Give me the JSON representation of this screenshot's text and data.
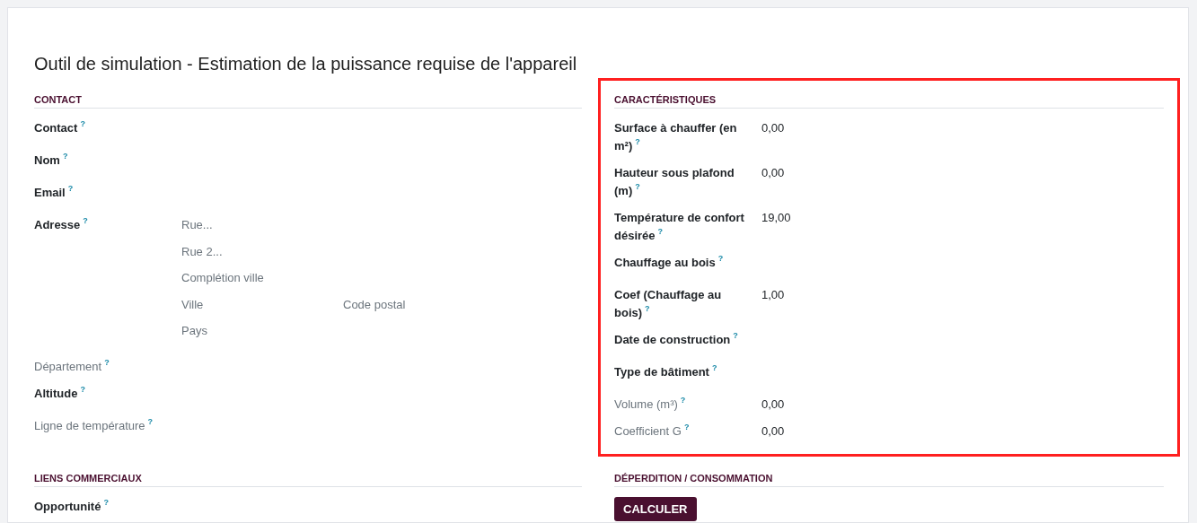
{
  "title": "Outil de simulation - Estimation de la puissance requise de l'appareil",
  "columns": [
    {
      "sections": [
        {
          "heading": "CONTACT",
          "highlighted": false,
          "fields": [
            {
              "kind": "text",
              "label": "Contact",
              "help": "?",
              "readonly": false
            },
            {
              "kind": "text",
              "label": "Nom",
              "help": "?",
              "readonly": false
            },
            {
              "kind": "text",
              "label": "Email",
              "help": "?",
              "readonly": false
            },
            {
              "kind": "address",
              "label": "Adresse",
              "help": "?",
              "readonly": false,
              "lines": [
                [
                  {
                    "placeholder": "Rue..."
                  }
                ],
                [
                  {
                    "placeholder": "Rue 2..."
                  }
                ],
                [
                  {
                    "placeholder": "Complétion ville"
                  }
                ],
                [
                  {
                    "placeholder": "Ville"
                  },
                  {
                    "placeholder": "Code postal"
                  }
                ],
                [
                  {
                    "placeholder": "Pays"
                  }
                ]
              ]
            },
            {
              "kind": "text",
              "label": "Département",
              "help": "?",
              "readonly": true
            },
            {
              "kind": "text",
              "label": "Altitude",
              "help": "?",
              "readonly": false
            },
            {
              "kind": "text",
              "label": "Ligne de température",
              "help": "?",
              "readonly": true
            }
          ]
        },
        {
          "heading": "LIENS COMMERCIAUX",
          "highlighted": false,
          "fields": [
            {
              "kind": "text",
              "label": "Opportunité",
              "help": "?",
              "readonly": false
            }
          ]
        }
      ]
    },
    {
      "sections": [
        {
          "heading": "CARACTÉRISTIQUES",
          "highlighted": true,
          "fields": [
            {
              "kind": "text",
              "label": "Surface à chauffer (en m²)",
              "help": "?",
              "readonly": false,
              "value": "0,00"
            },
            {
              "kind": "text",
              "label": "Hauteur sous plafond (m)",
              "help": "?",
              "readonly": false,
              "value": "0,00"
            },
            {
              "kind": "text",
              "label": "Température de confort désirée",
              "help": "?",
              "readonly": false,
              "value": "19,00"
            },
            {
              "kind": "text",
              "label": "Chauffage au bois",
              "help": "?",
              "readonly": false
            },
            {
              "kind": "text",
              "label": "Coef (Chauffage au bois)",
              "help": "?",
              "readonly": false,
              "value": "1,00"
            },
            {
              "kind": "text",
              "label": "Date de construction",
              "help": "?",
              "readonly": false
            },
            {
              "kind": "text",
              "label": "Type de bâtiment",
              "help": "?",
              "readonly": false
            },
            {
              "kind": "text",
              "label": "Volume (m³)",
              "help": "?",
              "readonly": true,
              "value": "0,00"
            },
            {
              "kind": "text",
              "label": "Coefficient G",
              "help": "?",
              "readonly": true,
              "value": "0,00"
            }
          ]
        },
        {
          "heading": "DÉPERDITION / CONSOMMATION",
          "highlighted": false,
          "buttons": [
            "CALCULER"
          ]
        }
      ]
    }
  ]
}
